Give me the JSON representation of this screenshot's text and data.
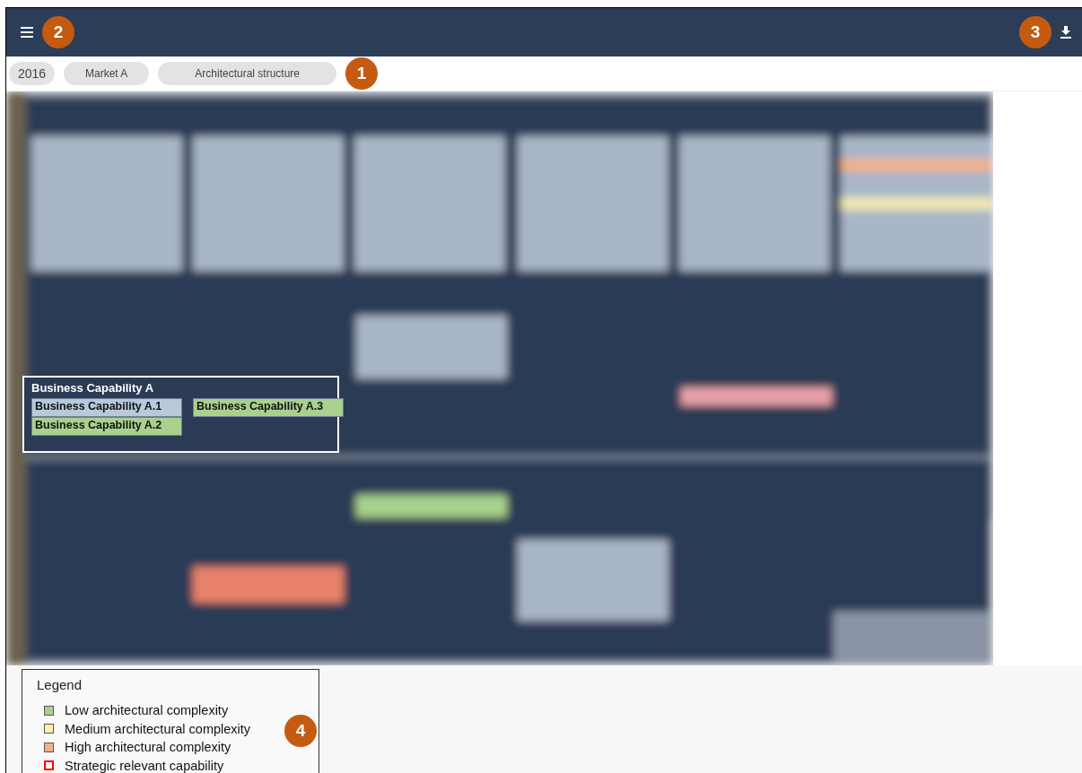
{
  "header": {
    "menu_callout": "2",
    "download_callout": "3"
  },
  "filters": [
    {
      "label": "2016",
      "kind": "year"
    },
    {
      "label": "Market A",
      "kind": "chip"
    },
    {
      "label": "Architectural structure",
      "kind": "chip"
    }
  ],
  "filters_callout": "1",
  "map": {
    "kind": "picture",
    "highlight": {
      "title": "Business Capability A",
      "children": [
        {
          "label": "Business Capability A.1",
          "color": "#b8c9dc"
        },
        {
          "label": "Business Capability A.2",
          "color": "#a9d18e"
        },
        {
          "label": "Business Capability A.3",
          "color": "#a9d18e"
        }
      ]
    }
  },
  "legend": {
    "title": "Legend",
    "callout": "4",
    "items": [
      {
        "label": "Low architectural complexity",
        "kind": "fill",
        "color": "#a9d18e"
      },
      {
        "label": "Medium architectural complexity",
        "kind": "fill",
        "color": "#fff2a8"
      },
      {
        "label": "High architectural complexity",
        "kind": "fill",
        "color": "#f4b183"
      },
      {
        "label": "Strategic relevant capability",
        "kind": "outline",
        "color": "#ff0000"
      }
    ]
  }
}
